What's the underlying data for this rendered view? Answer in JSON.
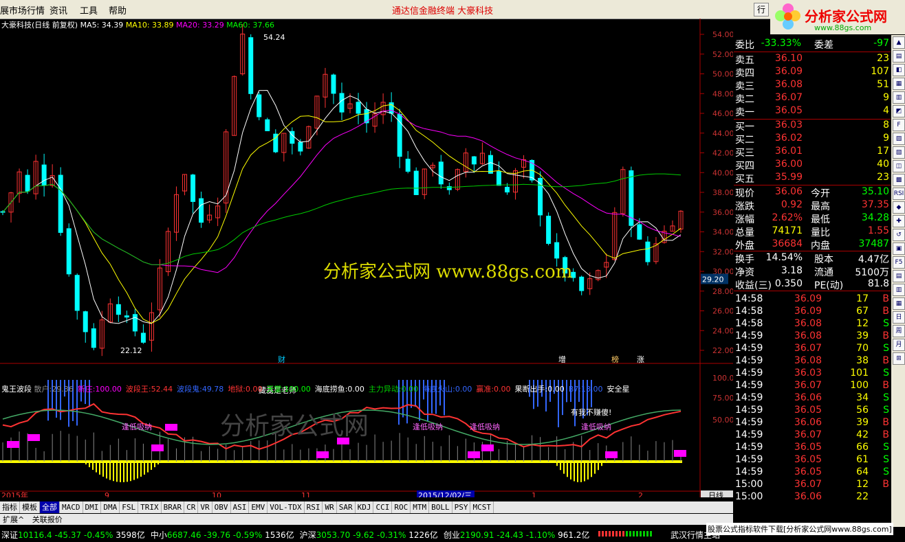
{
  "menu": {
    "items": [
      "展市场行情",
      "资讯",
      "工具",
      "帮助"
    ],
    "title": "通达信金融终端 大豪科技",
    "tab_btn": "行"
  },
  "logo": {
    "text": "分析家公式网",
    "url": "www.88gs.com"
  },
  "chart": {
    "ma_label": "大豪科技(日线 前复权)",
    "ma5": "MA5: 34.39",
    "ma10": "MA10: 33.89",
    "ma20": "MA20: 33.29",
    "ma60": "MA60: 37.66",
    "high_label": "54.24",
    "low_label": "22.12",
    "price_ticks": [
      "54.00",
      "52.00",
      "50.00",
      "48.00",
      "46.00",
      "44.00",
      "42.00",
      "40.00",
      "38.00",
      "36.00",
      "34.00",
      "32.00",
      "30.00",
      "28.00",
      "26.00",
      "24.00",
      "22.00"
    ],
    "cursor_price": "29.20",
    "watermark": "分析家公式网 www.88gs.com",
    "event_tags": [
      "财",
      "增",
      "榜",
      "涨"
    ],
    "date_labels": [
      "2015年",
      "9",
      "10",
      "11",
      "2015/12/02/三",
      "1",
      "2"
    ],
    "period": "日线"
  },
  "indicator": {
    "name": "鬼王波段",
    "items": [
      {
        "k": "散户:",
        "v": "29.36"
      },
      {
        "k": "新庄:",
        "v": "100.00"
      },
      {
        "k": "波段王:",
        "v": "52.44"
      },
      {
        "k": "波段鬼:",
        "v": "49.78"
      },
      {
        "k": "地狱:",
        "v": "0.00"
      },
      {
        "k": "天堂:",
        "v": "100.00"
      },
      {
        "k": "海底捞鱼:",
        "v": "0.00"
      },
      {
        "k": "主力异动:",
        "v": "0.00"
      },
      {
        "k": "海底火山:",
        "v": "0.00"
      },
      {
        "k": "赢准:",
        "v": "0.00"
      },
      {
        "k": "果断出手:",
        "v": "0.00"
      },
      {
        "k": "B7:",
        "v": "18.00"
      }
    ],
    "safe": "安全星",
    "ticks": [
      "100.0",
      "75.00",
      "50.00"
    ],
    "notes": [
      "藏磊是老师",
      "逢低吸纳",
      "逢低吸纳",
      "逢低吸纳",
      "逢低吸纳",
      "有我不赚傻!"
    ]
  },
  "tabs": [
    "指标",
    "模板",
    "全部",
    "MACD",
    "DMI",
    "DMA",
    "FSL",
    "TRIX",
    "BRAR",
    "CR",
    "VR",
    "OBV",
    "ASI",
    "EMV",
    "VOL-TDX",
    "RSI",
    "WR",
    "SAR",
    "KDJ",
    "CCI",
    "ROC",
    "MTM",
    "BOLL",
    "PSY",
    "MCST"
  ],
  "subtabs": [
    "扩展^",
    "关联报价"
  ],
  "quote": {
    "weibi": {
      "k": "委比",
      "v": "-33.33%",
      "k2": "委差",
      "v2": "-97"
    },
    "asks": [
      {
        "k": "卖五",
        "p": "36.10",
        "v": "23"
      },
      {
        "k": "卖四",
        "p": "36.09",
        "v": "107"
      },
      {
        "k": "卖三",
        "p": "36.08",
        "v": "51"
      },
      {
        "k": "卖二",
        "p": "36.07",
        "v": "9"
      },
      {
        "k": "卖一",
        "p": "36.05",
        "v": "4"
      }
    ],
    "bids": [
      {
        "k": "买一",
        "p": "36.03",
        "v": "8"
      },
      {
        "k": "买二",
        "p": "36.02",
        "v": "9"
      },
      {
        "k": "买三",
        "p": "36.01",
        "v": "17"
      },
      {
        "k": "买四",
        "p": "36.00",
        "v": "40"
      },
      {
        "k": "买五",
        "p": "35.99",
        "v": "23"
      }
    ],
    "stats": [
      {
        "k": "现价",
        "v": "36.06",
        "k2": "今开",
        "v2": "35.10"
      },
      {
        "k": "涨跌",
        "v": "0.92",
        "k2": "最高",
        "v2": "37.35"
      },
      {
        "k": "涨幅",
        "v": "2.62%",
        "k2": "最低",
        "v2": "34.28"
      },
      {
        "k": "总量",
        "v": "74171",
        "k2": "量比",
        "v2": "1.55"
      },
      {
        "k": "外盘",
        "v": "36684",
        "k2": "内盘",
        "v2": "37487"
      }
    ],
    "fund": [
      {
        "k": "换手",
        "v": "14.54%",
        "k2": "股本",
        "v2": "4.47亿"
      },
      {
        "k": "净资",
        "v": "3.18",
        "k2": "流通",
        "v2": "5100万"
      },
      {
        "k": "收益(三)",
        "v": "0.350",
        "k2": "PE(动)",
        "v2": "81.8"
      }
    ],
    "ticks": [
      {
        "t": "14:58",
        "p": "36.09",
        "v": "17",
        "s": "B"
      },
      {
        "t": "14:58",
        "p": "36.09",
        "v": "67",
        "s": "B"
      },
      {
        "t": "14:58",
        "p": "36.08",
        "v": "12",
        "s": "S"
      },
      {
        "t": "14:59",
        "p": "36.08",
        "v": "39",
        "s": "B"
      },
      {
        "t": "14:59",
        "p": "36.07",
        "v": "70",
        "s": "S"
      },
      {
        "t": "14:59",
        "p": "36.08",
        "v": "38",
        "s": "B"
      },
      {
        "t": "14:59",
        "p": "36.03",
        "v": "101",
        "s": "S"
      },
      {
        "t": "14:59",
        "p": "36.07",
        "v": "100",
        "s": "B"
      },
      {
        "t": "14:59",
        "p": "36.06",
        "v": "34",
        "s": "S"
      },
      {
        "t": "14:59",
        "p": "36.05",
        "v": "56",
        "s": "S"
      },
      {
        "t": "14:59",
        "p": "36.06",
        "v": "39",
        "s": "B"
      },
      {
        "t": "14:59",
        "p": "36.07",
        "v": "42",
        "s": "B"
      },
      {
        "t": "14:59",
        "p": "36.05",
        "v": "66",
        "s": "S"
      },
      {
        "t": "14:59",
        "p": "36.05",
        "v": "61",
        "s": "S"
      },
      {
        "t": "14:59",
        "p": "36.05",
        "v": "64",
        "s": "S"
      },
      {
        "t": "15:00",
        "p": "36.07",
        "v": "12",
        "s": "B"
      },
      {
        "t": "15:00",
        "p": "36.06",
        "v": "22",
        "s": ""
      }
    ]
  },
  "status": {
    "idx": [
      {
        "k": "深证",
        "v": "10116.4",
        "c": "-45.37",
        "pct": "-0.45%",
        "amt": "3598亿"
      },
      {
        "k": "中小",
        "v": "6687.46",
        "c": "-39.76",
        "pct": "-0.59%",
        "amt": "1536亿"
      },
      {
        "k": "沪深",
        "v": "3053.70",
        "c": "-9.62",
        "pct": "-0.31%",
        "amt": "1226亿"
      },
      {
        "k": "创业",
        "v": "2190.91",
        "c": "-24.43",
        "pct": "-1.10%",
        "amt": "961.2亿"
      }
    ],
    "server": "武汉行情主站",
    "ad": "股票公式指标软件下载[分析家公式网www.88gs.com]"
  }
}
